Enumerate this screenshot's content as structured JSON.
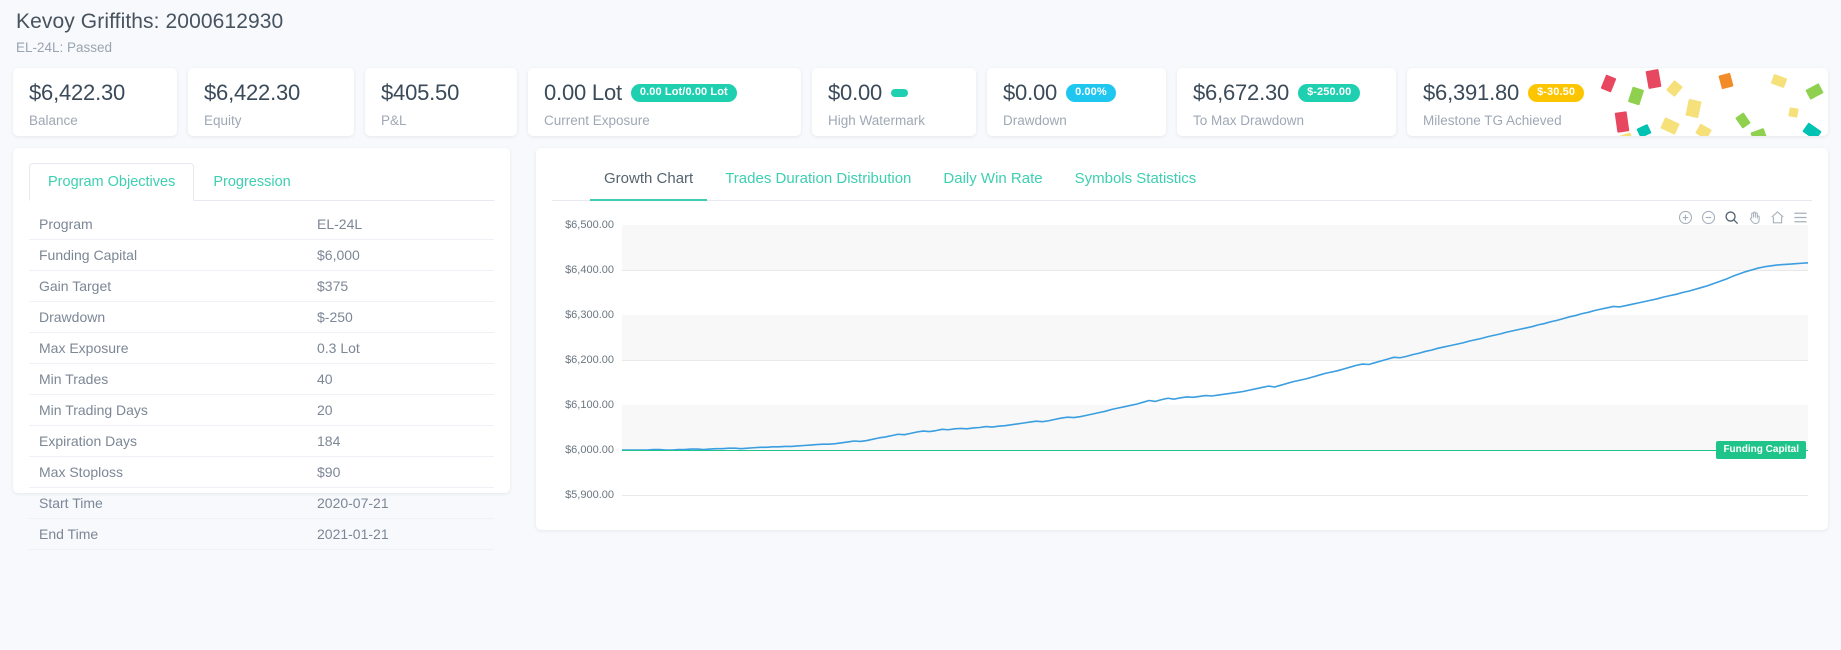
{
  "header": {
    "title": "Kevoy Griffiths: 2000612930",
    "subtitle": "EL-24L: Passed"
  },
  "kpis": [
    {
      "value": "$6,422.30",
      "label": "Balance",
      "badge": null,
      "badge_style": null
    },
    {
      "value": "$6,422.30",
      "label": "Equity",
      "badge": null,
      "badge_style": null
    },
    {
      "value": "$405.50",
      "label": "P&L",
      "badge": null,
      "badge_style": null
    },
    {
      "value": "0.00 Lot",
      "label": "Current Exposure",
      "badge": "0.00 Lot/0.00 Lot",
      "badge_style": "teal"
    },
    {
      "value": "$0.00",
      "label": "High Watermark",
      "badge": "",
      "badge_style": "dot"
    },
    {
      "value": "$0.00",
      "label": "Drawdown",
      "badge": "0.00%",
      "badge_style": "cyan"
    },
    {
      "value": "$6,672.30",
      "label": "To Max Drawdown",
      "badge": "$-250.00",
      "badge_style": "teal"
    },
    {
      "value": "$6,391.80",
      "label": "Milestone TG Achieved",
      "badge": "$-30.50",
      "badge_style": "yellow"
    }
  ],
  "left_panel": {
    "tabs": [
      {
        "label": "Program Objectives",
        "active": true
      },
      {
        "label": "Progression",
        "active": false
      }
    ],
    "rows": [
      {
        "key": "Program",
        "value": "EL-24L"
      },
      {
        "key": "Funding Capital",
        "value": "$6,000"
      },
      {
        "key": "Gain Target",
        "value": "$375"
      },
      {
        "key": "Drawdown",
        "value": "$-250"
      },
      {
        "key": "Max Exposure",
        "value": "0.3 Lot"
      },
      {
        "key": "Min Trades",
        "value": "40"
      },
      {
        "key": "Min Trading Days",
        "value": "20"
      },
      {
        "key": "Expiration Days",
        "value": "184"
      },
      {
        "key": "Max Stoploss",
        "value": "$90"
      },
      {
        "key": "Start Time",
        "value": "2020-07-21"
      },
      {
        "key": "End Time",
        "value": "2021-01-21"
      }
    ]
  },
  "chart_panel": {
    "tabs": [
      {
        "label": "Growth Chart",
        "active": true
      },
      {
        "label": "Trades Duration Distribution",
        "active": false
      },
      {
        "label": "Daily Win Rate",
        "active": false
      },
      {
        "label": "Symbols Statistics",
        "active": false
      }
    ],
    "toolbar": [
      {
        "name": "zoom-in-icon"
      },
      {
        "name": "zoom-out-icon"
      },
      {
        "name": "selection-zoom-icon"
      },
      {
        "name": "panning-icon"
      },
      {
        "name": "reset-zoom-icon"
      },
      {
        "name": "menu-icon"
      }
    ]
  },
  "chart_data": {
    "type": "line",
    "title": "Growth Chart",
    "xlabel": "",
    "ylabel": "",
    "ylim": [
      5900,
      6500
    ],
    "yticks": [
      "$5,900.00",
      "$6,000.00",
      "$6,100.00",
      "$6,200.00",
      "$6,300.00",
      "$6,400.00",
      "$6,500.00"
    ],
    "ytick_values": [
      5900,
      6000,
      6100,
      6200,
      6300,
      6400,
      6500
    ],
    "grid": true,
    "legend": "none",
    "annotations": [
      {
        "label": "Funding Capital",
        "value": 6000,
        "color": "#1fc48a",
        "position": "right"
      }
    ],
    "series": [
      {
        "name": "Equity",
        "color": "#3a9ee0",
        "values": [
          6000,
          6000,
          6000,
          6000,
          6000,
          6001,
          6001,
          6000,
          6000,
          6001,
          6001,
          6002,
          6002,
          6001,
          6002,
          6003,
          6003,
          6004,
          6004,
          6003,
          6004,
          6005,
          6006,
          6006,
          6007,
          6007,
          6008,
          6008,
          6009,
          6010,
          6011,
          6012,
          6013,
          6013,
          6014,
          6016,
          6018,
          6020,
          6019,
          6021,
          6024,
          6027,
          6029,
          6032,
          6035,
          6034,
          6037,
          6040,
          6042,
          6041,
          6043,
          6046,
          6045,
          6047,
          6048,
          6047,
          6049,
          6050,
          6052,
          6051,
          6053,
          6054,
          6056,
          6058,
          6060,
          6062,
          6064,
          6063,
          6065,
          6068,
          6071,
          6073,
          6072,
          6074,
          6077,
          6080,
          6083,
          6086,
          6090,
          6093,
          6096,
          6099,
          6102,
          6106,
          6110,
          6108,
          6112,
          6115,
          6113,
          6116,
          6118,
          6117,
          6119,
          6121,
          6120,
          6122,
          6124,
          6126,
          6128,
          6130,
          6133,
          6136,
          6139,
          6142,
          6140,
          6144,
          6148,
          6152,
          6155,
          6158,
          6162,
          6166,
          6170,
          6173,
          6176,
          6180,
          6184,
          6188,
          6191,
          6190,
          6194,
          6198,
          6202,
          6206,
          6205,
          6208,
          6212,
          6215,
          6219,
          6222,
          6226,
          6229,
          6232,
          6235,
          6238,
          6242,
          6245,
          6248,
          6252,
          6255,
          6258,
          6262,
          6265,
          6268,
          6271,
          6274,
          6278,
          6281,
          6285,
          6288,
          6292,
          6296,
          6299,
          6303,
          6306,
          6310,
          6313,
          6316,
          6319,
          6318,
          6321,
          6324,
          6327,
          6330,
          6333,
          6336,
          6340,
          6343,
          6346,
          6350,
          6353,
          6357,
          6361,
          6365,
          6370,
          6375,
          6380,
          6386,
          6391,
          6396,
          6400,
          6404,
          6407,
          6409,
          6411,
          6412,
          6413,
          6414,
          6415,
          6416
        ]
      }
    ]
  }
}
